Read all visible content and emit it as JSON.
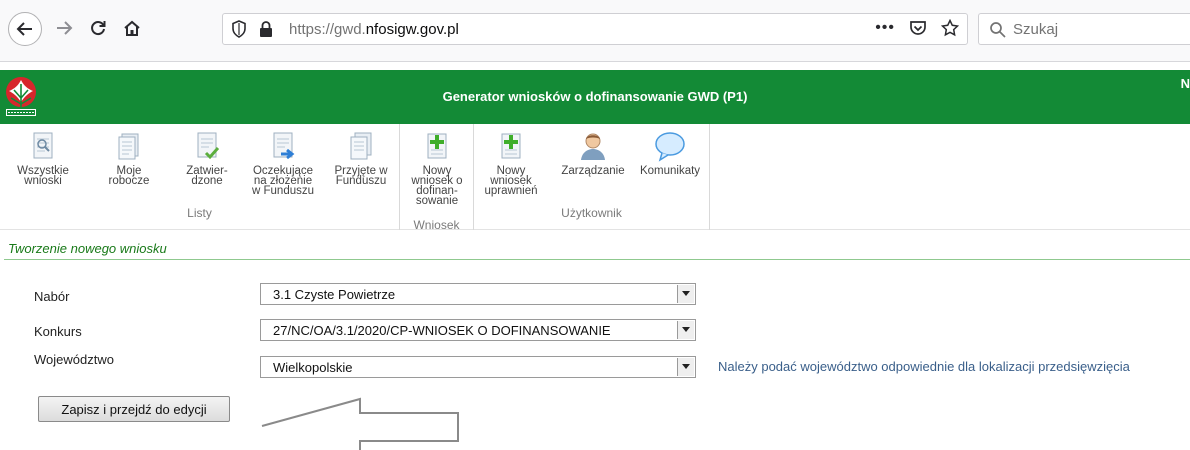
{
  "browser": {
    "url_prefix": "https://gwd.",
    "url_domain": "nfosigw.gov.pl",
    "search_placeholder": "Szukaj",
    "menu_dots": "•••"
  },
  "header": {
    "title": "Generator wniosków o dofinansowanie GWD (P1)",
    "cut_text": "N"
  },
  "toolbar": {
    "groups": [
      {
        "label": "Listy"
      },
      {
        "label": "Wniosek"
      },
      {
        "label": "Użytkownik"
      }
    ],
    "buttons": [
      {
        "label": "Wszystkie\nwnioski"
      },
      {
        "label": "Moje\nrobocze"
      },
      {
        "label": "Zatwier-\ndzone"
      },
      {
        "label": "Oczekujące\nna złożenie\nw Funduszu"
      },
      {
        "label": "Przyjęte w\nFunduszu"
      },
      {
        "label": "Nowy\nwniosek o\ndofinan-\nsowanie"
      },
      {
        "label": "Nowy\nwniosek\nuprawnień"
      },
      {
        "label": "Zarządzanie"
      },
      {
        "label": "Komunikaty"
      }
    ]
  },
  "form": {
    "section_title": "Tworzenie nowego wniosku",
    "fields": [
      {
        "label": "Nabór",
        "value": "3.1 Czyste Powietrze"
      },
      {
        "label": "Konkurs",
        "value": "27/NC/OA/3.1/2020/CP-WNIOSEK O DOFINANSOWANIE"
      },
      {
        "label": "Województwo",
        "value": "Wielkopolskie"
      }
    ],
    "hint": "Należy podać województwo odpowiednie dla lokalizacji przedsięwzięcia",
    "save_label": "Zapisz i przejdź do edycji"
  },
  "colors": {
    "header_green": "#138a36",
    "section_green": "#1a7a1a",
    "hint_blue": "#3a5f8a"
  }
}
